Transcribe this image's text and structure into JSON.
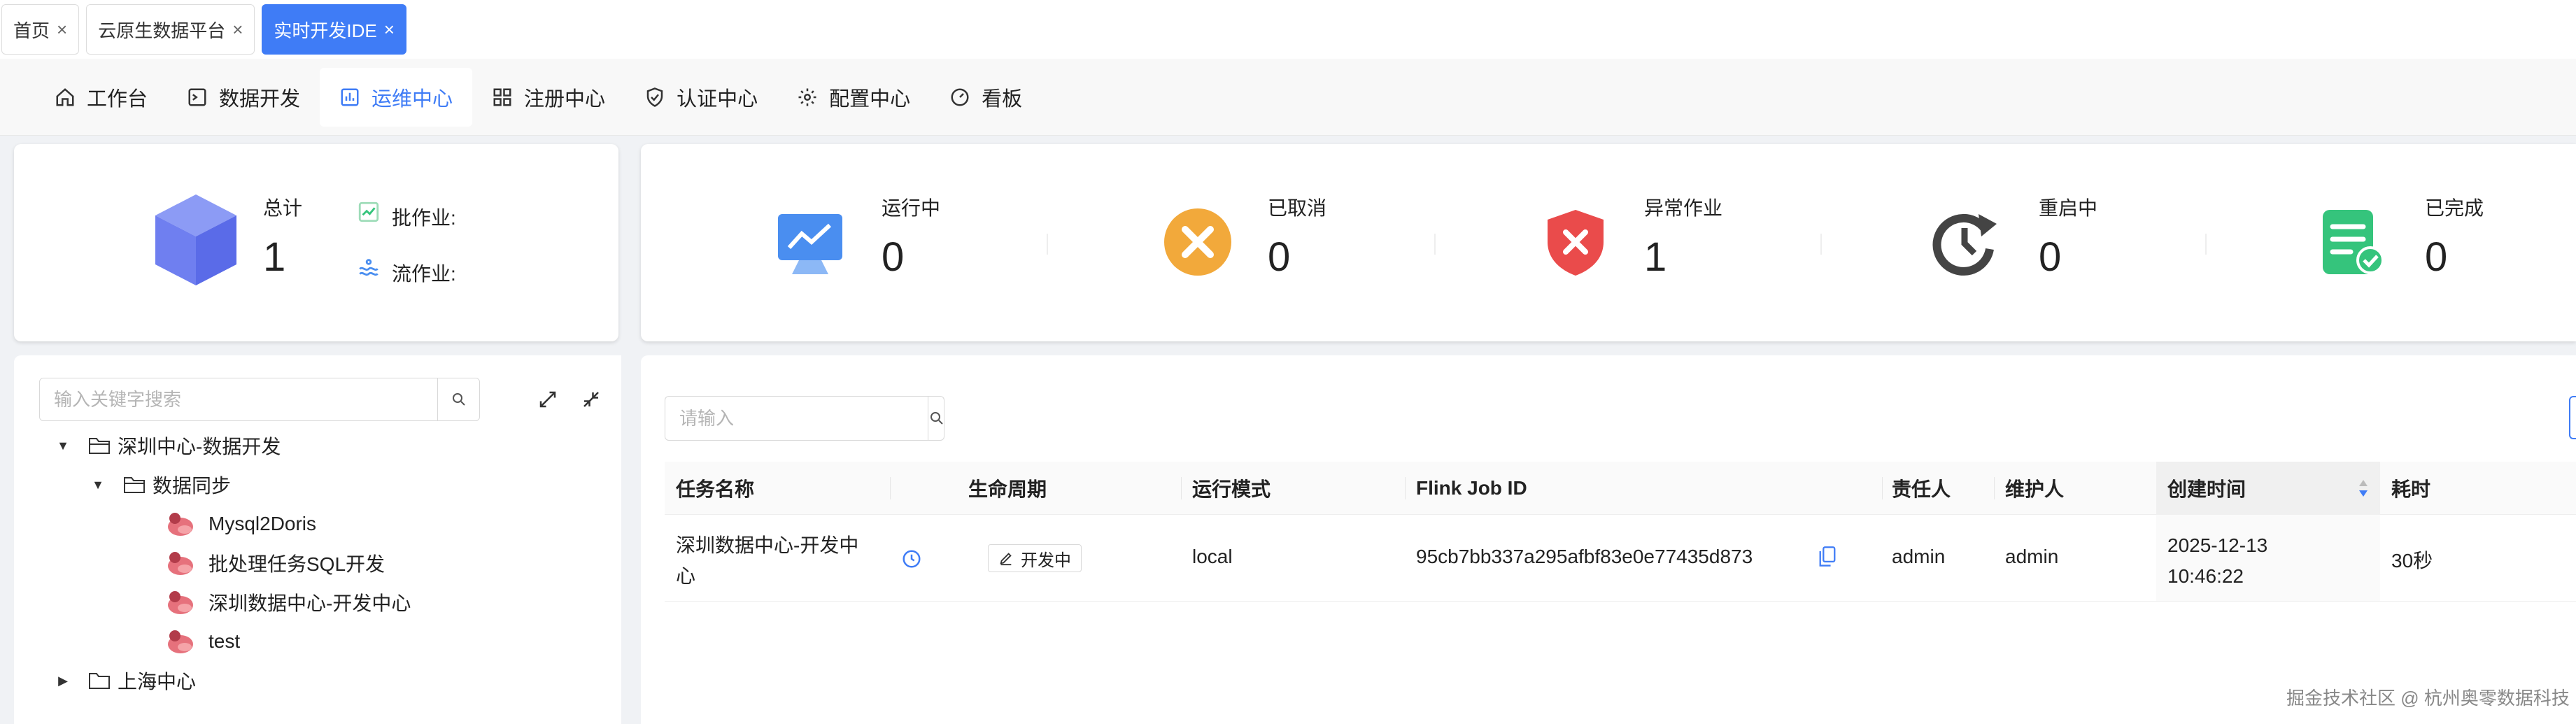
{
  "tabs": [
    {
      "label": "首页",
      "close": "×",
      "active": false
    },
    {
      "label": "云原生数据平台",
      "close": "×",
      "active": false
    },
    {
      "label": "实时开发IDE",
      "close": "×",
      "active": true
    }
  ],
  "nav": [
    {
      "label": "工作台",
      "icon": "home-icon"
    },
    {
      "label": "数据开发",
      "icon": "terminal-icon"
    },
    {
      "label": "运维中心",
      "icon": "chart-icon",
      "active": true
    },
    {
      "label": "注册中心",
      "icon": "grid-icon"
    },
    {
      "label": "认证中心",
      "icon": "shield-icon"
    },
    {
      "label": "配置中心",
      "icon": "gear-icon"
    },
    {
      "label": "看板",
      "icon": "gauge-icon"
    }
  ],
  "summary": {
    "total_label": "总计",
    "total_value": "1",
    "batch_label": "批作业:",
    "stream_label": "流作业:"
  },
  "status": [
    {
      "label": "运行中",
      "value": "0",
      "icon": "monitor-icon",
      "color": "#4a8ef0"
    },
    {
      "label": "已取消",
      "value": "0",
      "icon": "cancel-icon",
      "color": "#f2a93b"
    },
    {
      "label": "异常作业",
      "value": "1",
      "icon": "error-shield-icon",
      "color": "#ea4b4b"
    },
    {
      "label": "重启中",
      "value": "0",
      "icon": "restart-icon",
      "color": "#444444"
    },
    {
      "label": "已完成",
      "value": "0",
      "icon": "done-doc-icon",
      "color": "#35c47c"
    }
  ],
  "tree": {
    "search_placeholder": "输入关键字搜索",
    "nodes": [
      {
        "label": "深圳中心-数据开发",
        "caret": "▼",
        "level": 0,
        "type": "folder"
      },
      {
        "label": "数据同步",
        "caret": "▼",
        "level": 1,
        "type": "folder"
      },
      {
        "label": "Mysql2Doris",
        "level": 2,
        "type": "flink"
      },
      {
        "label": "批处理任务SQL开发",
        "level": 2,
        "type": "flink"
      },
      {
        "label": "深圳数据中心-开发中心",
        "level": 2,
        "type": "flink"
      },
      {
        "label": "test",
        "level": 2,
        "type": "flink"
      },
      {
        "label": "上海中心",
        "caret": "▶",
        "level": 0,
        "type": "folder"
      }
    ]
  },
  "table": {
    "search_placeholder": "请输入",
    "columns": [
      "任务名称",
      "生命周期",
      "运行模式",
      "Flink Job ID",
      "责任人",
      "维护人",
      "创建时间",
      "耗时"
    ],
    "rows": [
      {
        "name_line1": "深圳数据中心-开发中",
        "name_line2": "心",
        "lifecycle": "开发中",
        "mode": "local",
        "job_id": "95cb7bb337a295afbf83e0e77435d873",
        "owner": "admin",
        "maintainer": "admin",
        "created_date": "2025-12-13",
        "created_time": "10:46:22",
        "duration": "30秒"
      }
    ]
  },
  "watermark": "掘金技术社区 @ 杭州奥零数据科技"
}
